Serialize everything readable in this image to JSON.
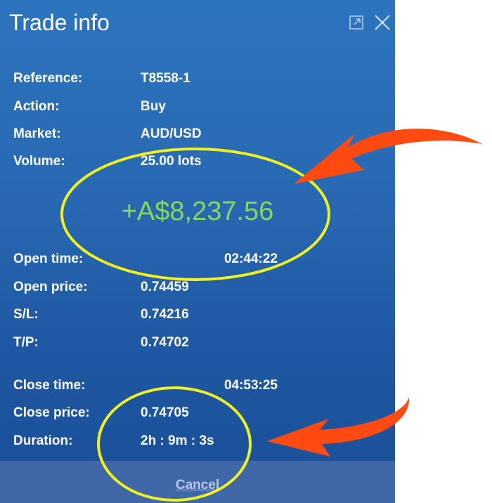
{
  "dialog": {
    "title": "Trade info",
    "icons": [
      "popout-icon",
      "close-icon"
    ]
  },
  "details_top": [
    {
      "label": "Reference:",
      "value": "T8558-1"
    },
    {
      "label": "Action:",
      "value": "Buy"
    },
    {
      "label": "Market:",
      "value": "AUD/USD"
    },
    {
      "label": "Volume:",
      "value": "25.00 lots"
    }
  ],
  "profit": "+A$8,237.56",
  "details_mid": [
    {
      "label": "Open time:",
      "value": "02:44:22"
    },
    {
      "label": "Open price:",
      "value": "0.74459"
    },
    {
      "label": "S/L:",
      "value": "0.74216"
    },
    {
      "label": "T/P:",
      "value": "0.74702"
    }
  ],
  "details_bottom": [
    {
      "label": "Close time:",
      "value": "04:53:25"
    },
    {
      "label": "Close price:",
      "value": "0.74705"
    },
    {
      "label": "Duration:",
      "value": "2h : 9m : 3s"
    }
  ],
  "footer": {
    "cancel_label": "Cancel"
  },
  "colors": {
    "panel_blue": "#2868b2",
    "profit_green": "#86d760",
    "highlight_yellow": "#f0f021",
    "arrow_red": "#ff4a12"
  }
}
